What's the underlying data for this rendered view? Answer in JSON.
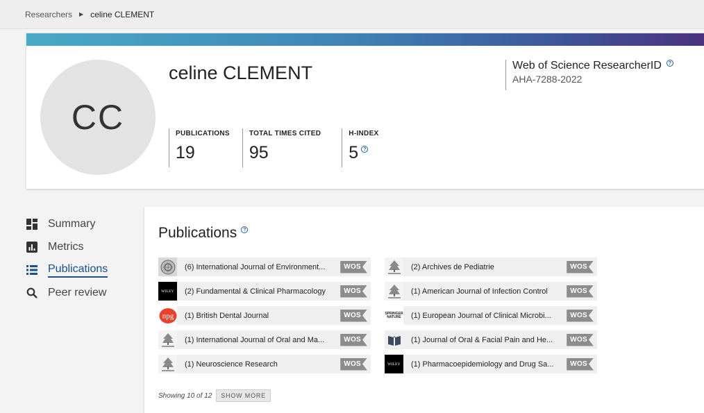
{
  "breadcrumb": {
    "root": "Researchers",
    "current": "celine CLEMENT"
  },
  "profile": {
    "initials": "CC",
    "name": "celine CLEMENT",
    "researcher_id_title": "Web of Science ResearcherID",
    "researcher_id": "AHA-7288-2022",
    "banner_colors": [
      "#49aac6",
      "#3c5a9c",
      "#4b2f7e"
    ]
  },
  "metrics": [
    {
      "label": "PUBLICATIONS",
      "value": "19"
    },
    {
      "label": "TOTAL TIMES CITED",
      "value": "95"
    },
    {
      "label": "H-INDEX",
      "value": "5"
    }
  ],
  "nav": [
    {
      "label": "Summary",
      "icon": "dashboard-icon"
    },
    {
      "label": "Metrics",
      "icon": "bar-chart-icon"
    },
    {
      "label": "Publications",
      "icon": "list-icon",
      "active": true
    },
    {
      "label": "Peer review",
      "icon": "search-icon"
    }
  ],
  "publications": {
    "title": "Publications",
    "items": [
      {
        "text": "(6) International Journal of Environment...",
        "badge": "WOS",
        "logo": "ijerph-logo"
      },
      {
        "text": "(2) Archives de Pediatrie",
        "badge": "WOS",
        "logo": "elsevier-logo"
      },
      {
        "text": "(2) Fundamental & Clinical Pharmacology",
        "badge": "WOS",
        "logo": "wiley-logo"
      },
      {
        "text": "(1) American Journal of Infection Control",
        "badge": "WOS",
        "logo": "elsevier-logo"
      },
      {
        "text": "(1) British Dental Journal",
        "badge": "WOS",
        "logo": "npg-logo"
      },
      {
        "text": "(1) European Journal of Clinical Microbi...",
        "badge": "WOS",
        "logo": "springer-nature-logo"
      },
      {
        "text": "(1) International Journal of Oral and Ma...",
        "badge": "WOS",
        "logo": "elsevier-logo"
      },
      {
        "text": "(1) Journal of Oral & Facial Pain and He...",
        "badge": "WOS",
        "logo": "book-logo"
      },
      {
        "text": "(1) Neuroscience Research",
        "badge": "WOS",
        "logo": "elsevier-logo"
      },
      {
        "text": "(1) Pharmacoepidemiology and Drug Sa...",
        "badge": "WOS",
        "logo": "wiley-logo"
      }
    ],
    "logo_text": {
      "wiley": "WILEY",
      "npg": "npg",
      "springer_top": "SPRINGER",
      "springer_bottom": "NATURE"
    },
    "showing_text": "Showing 10 of 12",
    "show_more_label": "SHOW MORE"
  }
}
